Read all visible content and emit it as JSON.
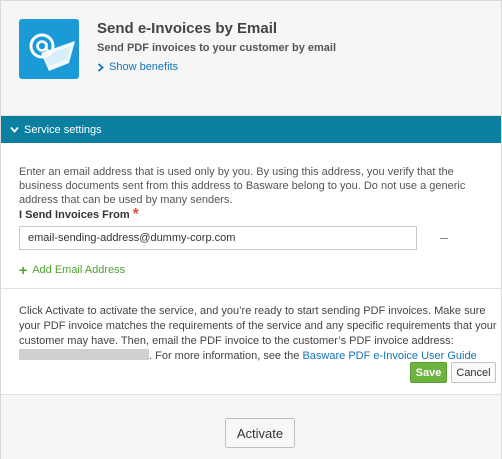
{
  "header": {
    "title": "Send e-Invoices by Email",
    "subtitle": "Send PDF invoices to your customer by email",
    "benefits_link": "Show benefits",
    "icon": "email-at-icon"
  },
  "settings": {
    "section_label": "Service settings",
    "description": "Enter an email address that is used only by you. By using this address, you verify that the business documents sent from this address to Basware belong to you. Do not use a generic address that can be used by many senders.",
    "field_label": "I Send Invoices From",
    "required_mark": "*",
    "email_value": "email-sending-address@dummy-corp.com",
    "add_email_label": "Add Email Address"
  },
  "activation": {
    "text_before": "Click Activate to activate the service, and you’re ready to start sending PDF invoices. Make sure your PDF invoice matches the requirements of the service and any specific requirements that your customer may have. Then, email the PDF invoice to the customer’s PDF invoice address:",
    "text_after": ". For more information, see the",
    "guide_link": "Basware PDF e-Invoice User Guide",
    "save_label": "Save",
    "cancel_label": "Cancel",
    "activate_label": "Activate"
  },
  "colors": {
    "section_bar": "#0a7fa0",
    "link": "#1473b8",
    "save": "#6cb33f",
    "add": "#4ea330",
    "required": "#e0533a",
    "icon_bg": "#1a9ad6"
  }
}
